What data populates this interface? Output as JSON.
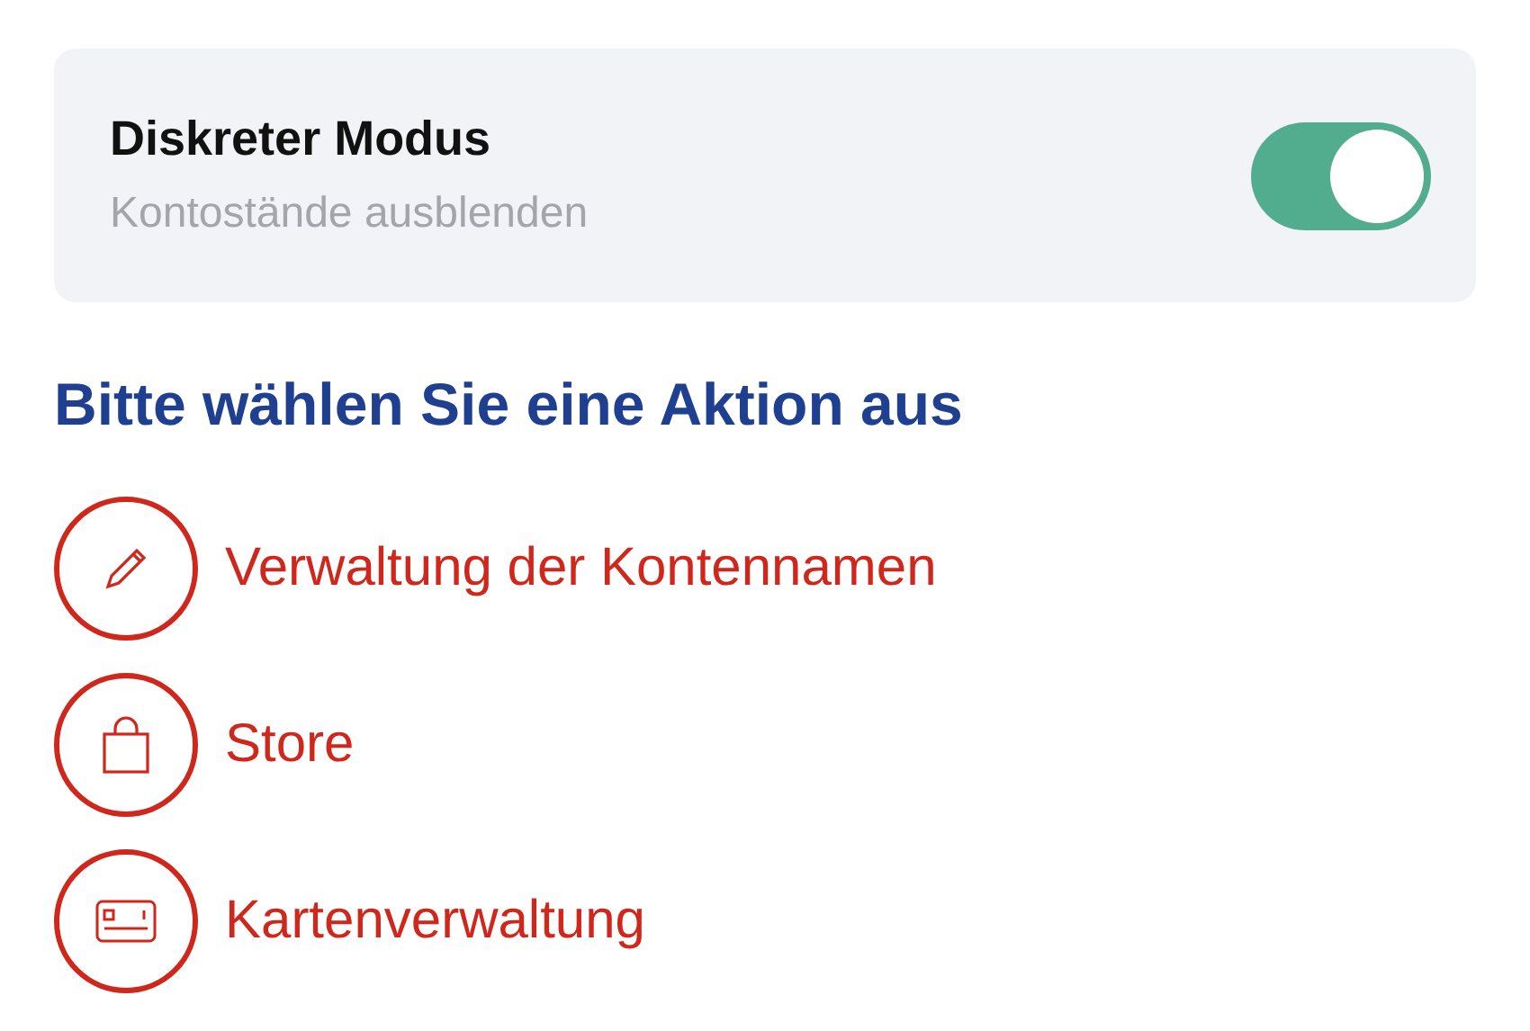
{
  "setting": {
    "title": "Diskreter Modus",
    "subtitle": "Kontostände ausblenden",
    "on": true
  },
  "heading": "Bitte wählen Sie eine Aktion aus",
  "actions": [
    {
      "kind": "pencil",
      "label": "Verwaltung der Kontennamen"
    },
    {
      "kind": "bag",
      "label": "Store"
    },
    {
      "kind": "card",
      "label": "Kartenverwaltung"
    }
  ]
}
